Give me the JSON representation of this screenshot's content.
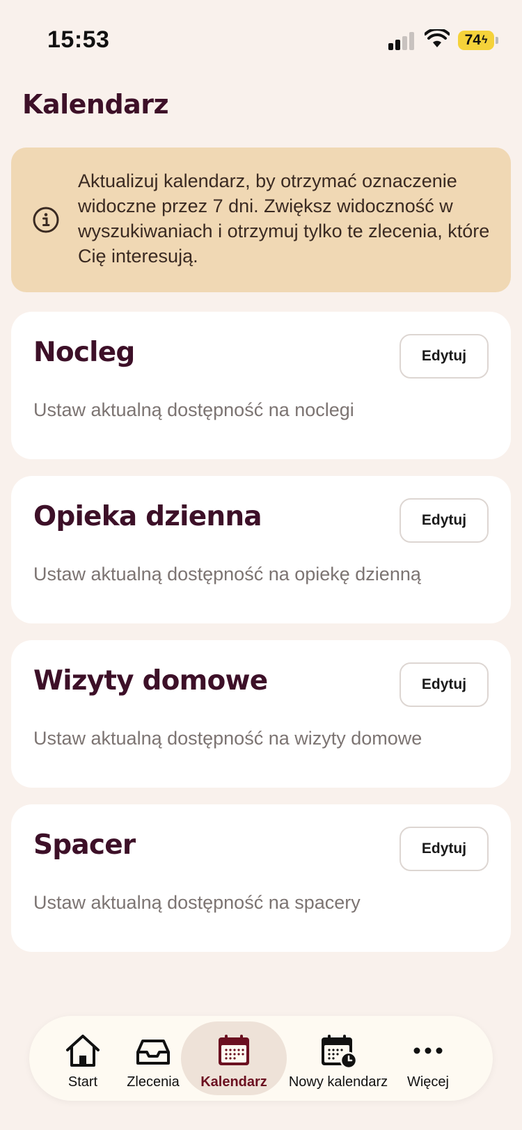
{
  "status_bar": {
    "time": "15:53",
    "battery": "74"
  },
  "page": {
    "title": "Kalendarz"
  },
  "banner": {
    "icon": "info-icon",
    "text": "Aktualizuj kalendarz, by otrzymać oznaczenie widoczne przez 7 dni. Zwiększ widoczność w wyszukiwaniach i otrzymuj tylko te zlecenia, które Cię interesują."
  },
  "cards": [
    {
      "title": "Nocleg",
      "description": "Ustaw aktualną dostępność na noclegi",
      "button": "Edytuj"
    },
    {
      "title": "Opieka dzienna",
      "description": "Ustaw aktualną dostępność na opiekę dzienną",
      "button": "Edytuj"
    },
    {
      "title": "Wizyty domowe",
      "description": "Ustaw aktualną dostępność na wizyty domowe",
      "button": "Edytuj"
    },
    {
      "title": "Spacer",
      "description": "Ustaw aktualną dostępność na spacery",
      "button": "Edytuj"
    }
  ],
  "tabbar": {
    "items": [
      {
        "label": "Start",
        "icon": "home-icon"
      },
      {
        "label": "Zlecenia",
        "icon": "inbox-icon"
      },
      {
        "label": "Kalendarz",
        "icon": "calendar-icon",
        "active": true
      },
      {
        "label": "Nowy kalendarz",
        "icon": "calendar-clock-icon"
      },
      {
        "label": "Więcej",
        "icon": "more-icon"
      }
    ]
  },
  "colors": {
    "background": "#f9f1ec",
    "banner": "#f0d8b4",
    "title": "#3d1028",
    "active_tab": "#6b1020"
  }
}
